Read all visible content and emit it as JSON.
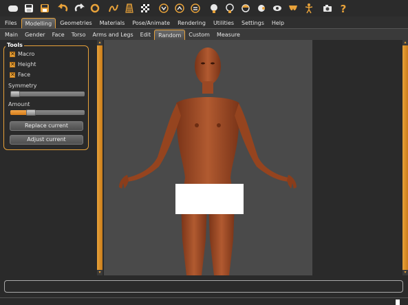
{
  "toolbar": {
    "icons": [
      "window-icon",
      "save-icon",
      "export-icon",
      "undo-icon",
      "redo-icon",
      "reset-icon",
      "wireframe-icon",
      "grid-icon",
      "checkerboard-icon",
      "front-view-icon",
      "back-view-icon",
      "side-view-icon",
      "skin-head-icon",
      "neck-icon",
      "hair-icon",
      "ear-icon",
      "eye-icon",
      "body-pose-icon",
      "skeleton-icon",
      "camera-icon",
      "help-icon"
    ]
  },
  "menu": {
    "tabs": [
      "Files",
      "Modelling",
      "Geometries",
      "Materials",
      "Pose/Animate",
      "Rendering",
      "Utilities",
      "Settings",
      "Help"
    ],
    "active": "Modelling"
  },
  "submenu": {
    "tabs": [
      "Main",
      "Gender",
      "Face",
      "Torso",
      "Arms and Legs",
      "Edit",
      "Random",
      "Custom",
      "Measure"
    ],
    "active": "Random"
  },
  "tools": {
    "title": "Tools",
    "checkboxes": [
      {
        "label": "Macro",
        "checked": true
      },
      {
        "label": "Height",
        "checked": true
      },
      {
        "label": "Face",
        "checked": true
      }
    ],
    "symmetry": {
      "label": "Symmetry",
      "value": 0
    },
    "amount": {
      "label": "Amount",
      "value": 0.25
    },
    "replace_button": "Replace current",
    "adjust_button": "Adjust current"
  },
  "colors": {
    "accent": "#e8a23a",
    "skin": "#a8502a",
    "viewport_bg": "#4a4a4a"
  }
}
